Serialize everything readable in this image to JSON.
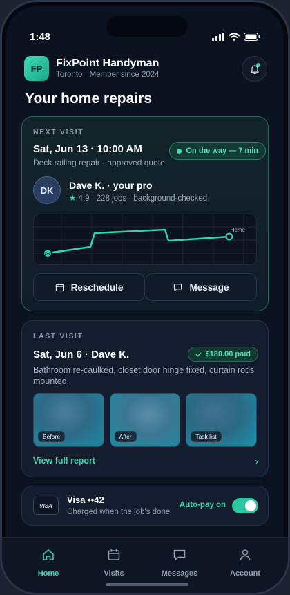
{
  "status": {
    "time": "1:48"
  },
  "brand": {
    "logo": "FP",
    "name": "FixPoint Handyman",
    "subtitle": "Toronto · Member since 2024"
  },
  "page_title": "Your home repairs",
  "next_visit": {
    "eyebrow": "NEXT VISIT",
    "datetime": "Sat, Jun 13 · 10:00 AM",
    "description": "Deck railing repair · approved quote",
    "status_pill": "On the way — 7 min",
    "pro_initials": "DK",
    "pro_name": "Dave K. · your pro",
    "pro_meta": "4.9 · 228 jobs · background-checked",
    "map_home_label": "Home",
    "map_pro_marker": "DK",
    "reschedule_label": "Reschedule",
    "message_label": "Message"
  },
  "last_visit": {
    "eyebrow": "LAST VISIT",
    "title": "Sat, Jun 6 · Dave K.",
    "paid_pill": "$180.00 paid",
    "summary": "Bathroom re-caulked, closet door hinge fixed, curtain rods mounted.",
    "photos": [
      {
        "tag": "Before"
      },
      {
        "tag": "After"
      },
      {
        "tag": "Task list"
      }
    ],
    "report_link": "View full report"
  },
  "payment": {
    "card_brand": "VISA",
    "title": "Visa ••42",
    "subtitle": "Charged when the job's done",
    "autopay_label": "Auto-pay on",
    "autopay_enabled": true
  },
  "tabs": [
    {
      "label": "Home",
      "icon": "home-icon",
      "active": true
    },
    {
      "label": "Visits",
      "icon": "calendar-icon",
      "active": false
    },
    {
      "label": "Messages",
      "icon": "chat-icon",
      "active": false
    },
    {
      "label": "Account",
      "icon": "person-icon",
      "active": false
    }
  ],
  "colors": {
    "accent": "#36d6ad",
    "background": "#0b1220",
    "card": "#141d2d"
  }
}
